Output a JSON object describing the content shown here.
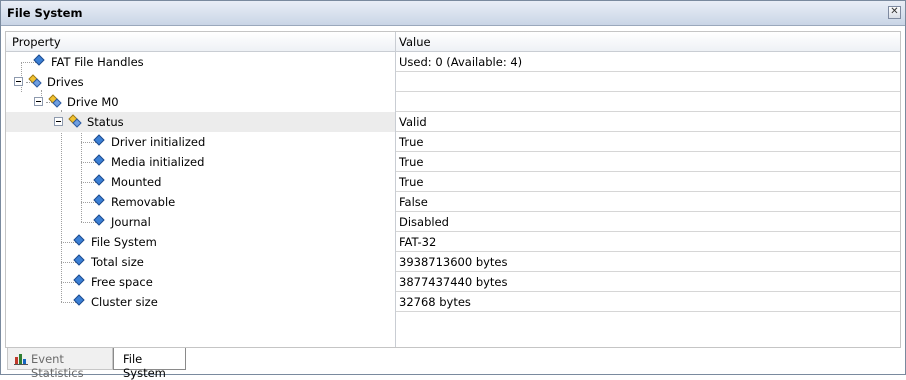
{
  "window": {
    "title": "File System"
  },
  "header": {
    "property": "Property",
    "value": "Value"
  },
  "rows": [
    {
      "label": "FAT File Handles",
      "value": "Used: 0 (Available: 4)"
    },
    {
      "label": "Drives",
      "value": ""
    },
    {
      "label": "Drive M0",
      "value": ""
    },
    {
      "label": "Status",
      "value": "Valid"
    },
    {
      "label": "Driver initialized",
      "value": "True"
    },
    {
      "label": "Media initialized",
      "value": "True"
    },
    {
      "label": "Mounted",
      "value": "True"
    },
    {
      "label": "Removable",
      "value": "False"
    },
    {
      "label": "Journal",
      "value": "Disabled"
    },
    {
      "label": "File System",
      "value": "FAT-32"
    },
    {
      "label": "Total size",
      "value": "3938713600 bytes"
    },
    {
      "label": "Free space",
      "value": "3877437440 bytes"
    },
    {
      "label": "Cluster size",
      "value": "32768 bytes"
    }
  ],
  "tabs": [
    {
      "label": "Event Statistics",
      "icon": "bar-chart-icon"
    },
    {
      "label": "File System"
    }
  ],
  "icons": {
    "property": "property-diamond-icon",
    "group": "property-group-icon",
    "close": "close-icon"
  }
}
